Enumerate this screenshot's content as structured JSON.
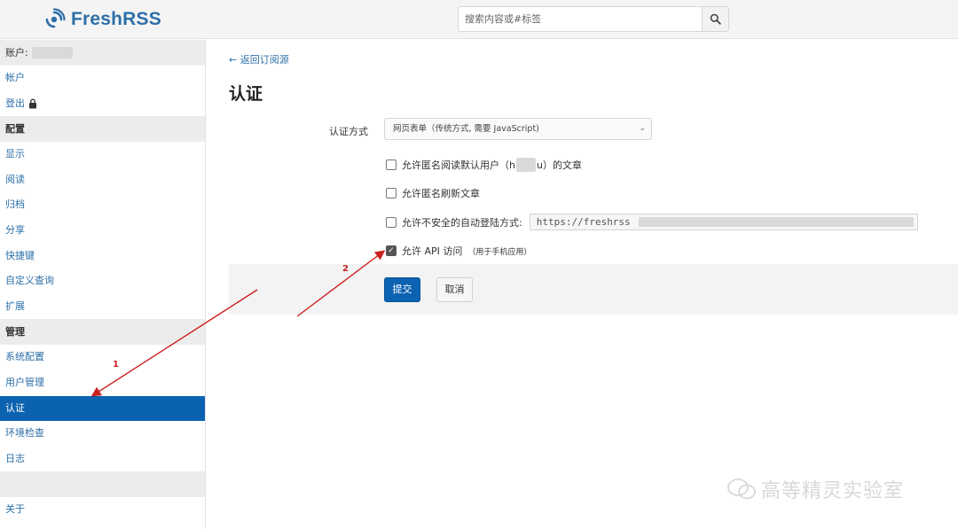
{
  "header": {
    "app_name": "FreshRSS",
    "search_placeholder": "搜索内容或#标签"
  },
  "sidebar": {
    "account_label": "账户:",
    "groups": [
      {
        "heading": null,
        "items": [
          "帐户",
          "登出"
        ]
      },
      {
        "heading": "配置",
        "items": [
          "显示",
          "阅读",
          "归档",
          "分享",
          "快捷键",
          "自定义查询",
          "扩展"
        ]
      },
      {
        "heading": "管理",
        "items": [
          "系统配置",
          "用户管理",
          "认证",
          "环境检查",
          "日志"
        ]
      }
    ],
    "active_item": "认证",
    "about": "关于"
  },
  "main": {
    "back_link": "← 返回订阅源",
    "title": "认证",
    "auth_method_label": "认证方式",
    "auth_method_value": "网页表单（传统方式, 需要 JavaScript)",
    "options": [
      {
        "label_prefix": "允许匿名阅读默认用户（h",
        "label_suffix": "u）的文章",
        "checked": false
      },
      {
        "label": "允许匿名刷新文章",
        "checked": false
      },
      {
        "label": "允许不安全的自动登陆方式:",
        "url": "https://freshrss",
        "checked": false
      },
      {
        "label": "允许 API 访问",
        "note": "（用于手机应用）",
        "checked": true
      }
    ],
    "submit": "提交",
    "cancel": "取消"
  },
  "annotations": {
    "arrow1_label": "1",
    "arrow2_label": "2",
    "color": "#cc1f1f"
  },
  "watermark": "高等精灵实验室"
}
